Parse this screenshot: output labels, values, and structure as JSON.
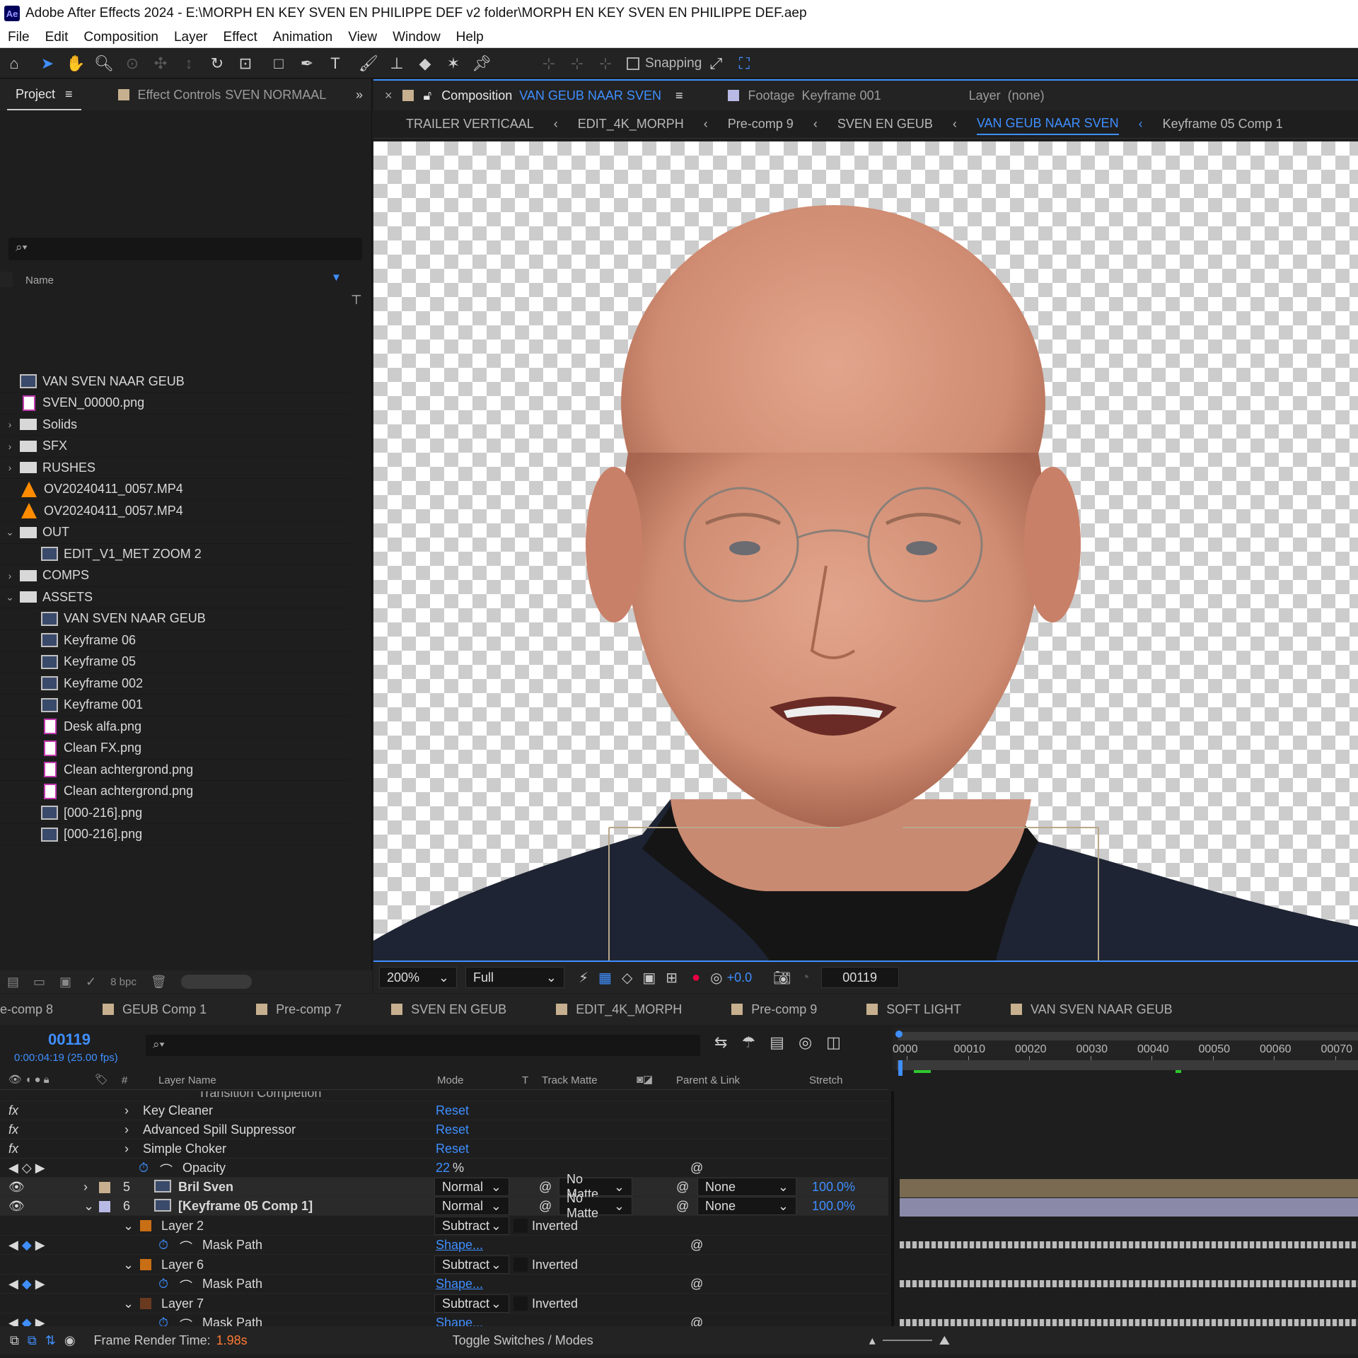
{
  "window": {
    "title": "Adobe After Effects 2024 - E:\\MORPH EN KEY SVEN EN PHILIPPE DEF v2 folder\\MORPH EN KEY SVEN EN PHILIPPE DEF.aep",
    "logo": "Ae"
  },
  "menu": [
    "File",
    "Edit",
    "Composition",
    "Layer",
    "Effect",
    "Animation",
    "View",
    "Window",
    "Help"
  ],
  "toolbar": {
    "snapping": "Snapping"
  },
  "project": {
    "tab_project": "Project",
    "tab_effect": "Effect Controls",
    "tab_effect_target": "SVEN NORMAAL",
    "search_placeholder": "⌕▾",
    "col_name": "Name",
    "items": [
      {
        "name": "VAN SVEN NAAR GEUB",
        "type": "comp",
        "indent": 0,
        "arrow": ""
      },
      {
        "name": "SVEN_00000.png",
        "type": "img",
        "indent": 0,
        "arrow": ""
      },
      {
        "name": "Solids",
        "type": "folder",
        "indent": 0,
        "arrow": "›"
      },
      {
        "name": "SFX",
        "type": "folder",
        "indent": 0,
        "arrow": "›"
      },
      {
        "name": "RUSHES",
        "type": "folder",
        "indent": 0,
        "arrow": "›"
      },
      {
        "name": "OV20240411_0057.MP4",
        "type": "vlc",
        "indent": 0,
        "arrow": ""
      },
      {
        "name": "OV20240411_0057.MP4",
        "type": "vlc",
        "indent": 0,
        "arrow": ""
      },
      {
        "name": "OUT",
        "type": "folder",
        "indent": 0,
        "arrow": "⌄"
      },
      {
        "name": "EDIT_V1_MET ZOOM 2",
        "type": "comp",
        "indent": 1,
        "arrow": ""
      },
      {
        "name": "COMPS",
        "type": "folder",
        "indent": 0,
        "arrow": "›"
      },
      {
        "name": "ASSETS",
        "type": "folder",
        "indent": 0,
        "arrow": "⌄"
      },
      {
        "name": "VAN SVEN NAAR GEUB",
        "type": "comp",
        "indent": 1,
        "arrow": ""
      },
      {
        "name": "Keyframe 06",
        "type": "comp",
        "indent": 1,
        "arrow": ""
      },
      {
        "name": "Keyframe 05",
        "type": "comp",
        "indent": 1,
        "arrow": ""
      },
      {
        "name": "Keyframe 002",
        "type": "comp",
        "indent": 1,
        "arrow": ""
      },
      {
        "name": "Keyframe 001",
        "type": "comp",
        "indent": 1,
        "arrow": ""
      },
      {
        "name": "Desk alfa.png",
        "type": "img",
        "indent": 1,
        "arrow": ""
      },
      {
        "name": "Clean FX.png",
        "type": "img",
        "indent": 1,
        "arrow": ""
      },
      {
        "name": "Clean achtergrond.png",
        "type": "img",
        "indent": 1,
        "arrow": ""
      },
      {
        "name": "Clean achtergrond.png",
        "type": "img",
        "indent": 1,
        "arrow": ""
      },
      {
        "name": "[000-216].png",
        "type": "comp",
        "indent": 1,
        "arrow": ""
      },
      {
        "name": "[000-216].png",
        "type": "comp",
        "indent": 1,
        "arrow": ""
      }
    ],
    "bpc": "8 bpc"
  },
  "comp": {
    "tab_label": "Composition",
    "tab_name": "VAN GEUB NAAR SVEN",
    "footage_label": "Footage",
    "footage_name": "Keyframe 001",
    "layer_label": "Layer",
    "layer_name": "(none)",
    "breadcrumb": [
      "TRAILER VERTICAAL",
      "EDIT_4K_MORPH",
      "Pre-comp 9",
      "SVEN EN GEUB",
      "VAN GEUB NAAR SVEN",
      "Keyframe 05 Comp 1"
    ],
    "zoom": "200%",
    "resolution": "Full",
    "exposure": "+0.0",
    "frame": "00119"
  },
  "timeline": {
    "tabs": [
      "e-comp 8",
      "GEUB Comp 1",
      "Pre-comp 7",
      "SVEN EN GEUB",
      "EDIT_4K_MORPH",
      "Pre-comp 9",
      "SOFT LIGHT",
      "VAN SVEN NAAR GEUB"
    ],
    "timecode": "00119",
    "fps": "0:00:04:19 (25.00 fps)",
    "search_placeholder": "⌕▾",
    "cols": {
      "num": "#",
      "name": "Layer Name",
      "mode": "Mode",
      "t": "T",
      "matte": "Track Matte",
      "parent": "Parent & Link",
      "stretch": "Stretch"
    },
    "ruler": [
      "0000",
      "00010",
      "00020",
      "00030",
      "00040",
      "00050",
      "00060",
      "00070"
    ],
    "rows": {
      "partial": "Transition Completion",
      "fx1": "Key Cleaner",
      "fx2": "Advanced Spill Suppressor",
      "fx3": "Simple Choker",
      "reset": "Reset",
      "opacity": "Opacity",
      "opacity_val": "22",
      "pct": "%",
      "l5_num": "5",
      "l5_name": "Bril Sven",
      "l5_mode": "Normal",
      "l5_matte": "No Matte",
      "l5_parent": "None",
      "l5_stretch": "100.0%",
      "l6_num": "6",
      "l6_name": "[Keyframe 05 Comp 1]",
      "l6_mode": "Normal",
      "l6_matte": "No Matte",
      "l6_parent": "None",
      "l6_stretch": "100.0%",
      "m1": "Layer 2",
      "m2": "Layer 6",
      "m3": "Layer 7",
      "mask_mode": "Subtract",
      "inverted": "Inverted",
      "maskpath": "Mask Path",
      "shape": "Shape..."
    },
    "footer": {
      "render_label": "Frame Render Time:",
      "render_val": "1.98s",
      "toggle": "Toggle Switches / Modes"
    }
  },
  "colors": {
    "accent": "#3f8fff",
    "l5": "#7a6a52",
    "l6": "#8a8aa8",
    "mask_orange": "#c86e14",
    "render": "#ff7a33"
  }
}
